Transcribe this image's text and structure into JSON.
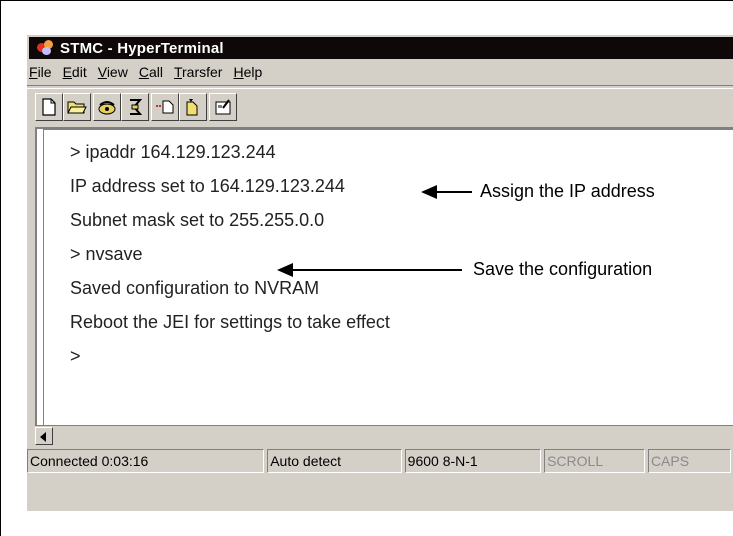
{
  "window": {
    "title": "STMC - HyperTerminal"
  },
  "menubar": {
    "items": [
      {
        "key": "F",
        "rest": "ile"
      },
      {
        "key": "E",
        "rest": "dit"
      },
      {
        "key": "V",
        "rest": "iew"
      },
      {
        "key": "C",
        "rest": "all"
      },
      {
        "key": "T",
        "rest": "rarsfer"
      },
      {
        "key": "H",
        "rest": "elp"
      }
    ]
  },
  "toolbar": {
    "icons": [
      "new-document-icon",
      "open-folder-icon",
      "connect-phone-icon",
      "disconnect-phone-icon",
      "send-file-icon",
      "receive-file-icon",
      "properties-icon"
    ]
  },
  "terminal": {
    "lines": [
      "> ipaddr 164.129.123.244",
      "IP address set to 164.129.123.244",
      "Subnet mask set to 255.255.0.0",
      "> nvsave",
      "Saved configuration to NVRAM",
      "Reboot the JEI for settings to take effect",
      ">"
    ]
  },
  "annotations": {
    "assign_ip": "Assign the IP address",
    "save_config": "Save the configuration"
  },
  "statusbar": {
    "connected": "Connected 0:03:16",
    "detect": "Auto detect",
    "settings": "9600 8-N-1",
    "scroll": "SCROLL",
    "caps": "CAPS"
  }
}
